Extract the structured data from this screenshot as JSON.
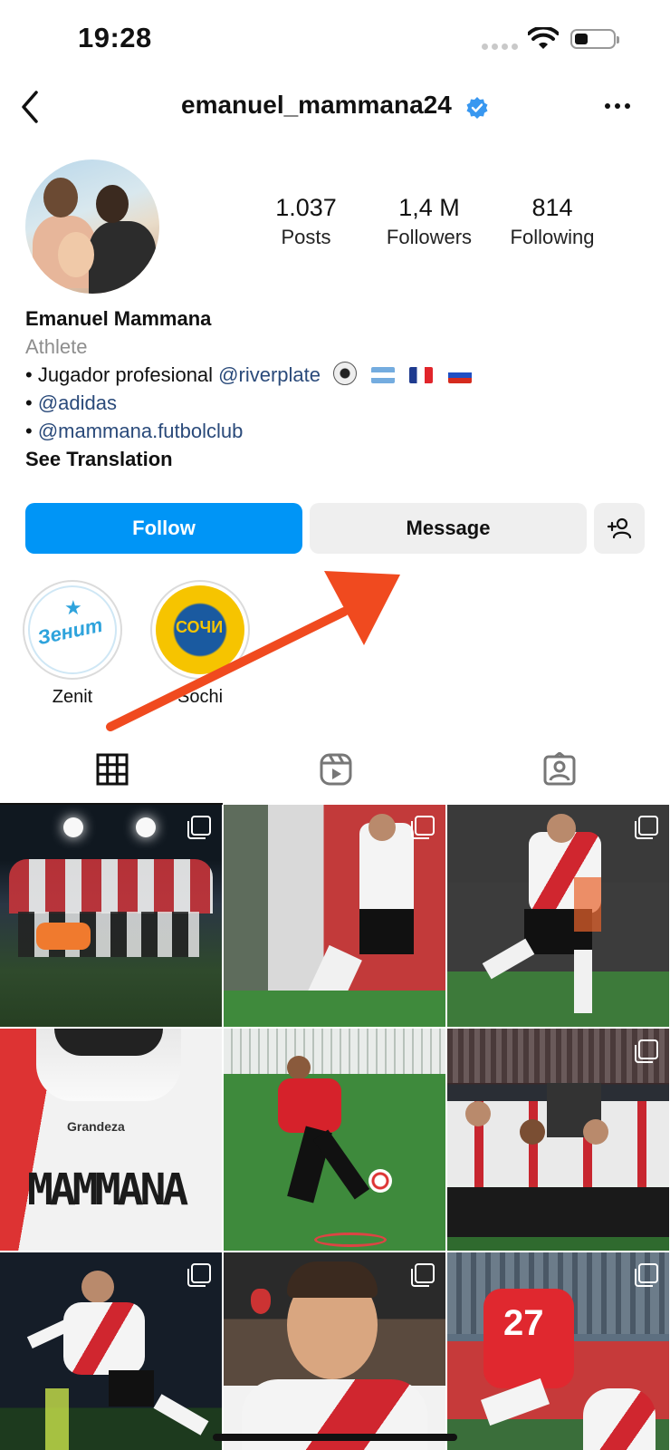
{
  "status_bar": {
    "time": "19:28"
  },
  "header": {
    "username": "emanuel_mammana24"
  },
  "profile": {
    "stats": [
      {
        "value": "1.037",
        "label": "Posts"
      },
      {
        "value": "1,4 M",
        "label": "Followers"
      },
      {
        "value": "814",
        "label": "Following"
      }
    ],
    "name": "Emanuel Mammana",
    "category": "Athlete",
    "bio": {
      "line1_prefix": "• Jugador profesional ",
      "line1_mention": "@riverplate",
      "line2_prefix": "• ",
      "line2_mention": "@adidas",
      "line3_prefix": "• ",
      "line3_mention": "@mammana.futbolclub"
    },
    "see_translation": "See Translation"
  },
  "actions": {
    "follow": "Follow",
    "message": "Message"
  },
  "highlights": [
    {
      "label": "Zenit",
      "logo_text": "Зенит"
    },
    {
      "label": "Sochi",
      "logo_text": "СОЧИ"
    }
  ],
  "tabs": [
    {
      "name": "posts-grid",
      "icon": "grid-icon",
      "active": true
    },
    {
      "name": "reels",
      "icon": "reels-icon",
      "active": false
    },
    {
      "name": "tagged",
      "icon": "tagged-icon",
      "active": false
    }
  ],
  "posts": [
    {
      "multi": true
    },
    {
      "multi": true
    },
    {
      "multi": true
    },
    {
      "multi": false
    },
    {
      "multi": false
    },
    {
      "multi": true
    },
    {
      "multi": true
    },
    {
      "multi": true
    },
    {
      "multi": true
    }
  ],
  "post_texts": {
    "jersey_sponsor": "Grandeza",
    "jersey_name": "MAMMANA",
    "jersey_number": "27"
  },
  "colors": {
    "follow_button": "#0095f6",
    "verified": "#3897f0",
    "link": "#2a4a7a",
    "annotation_arrow": "#f04a1f"
  }
}
